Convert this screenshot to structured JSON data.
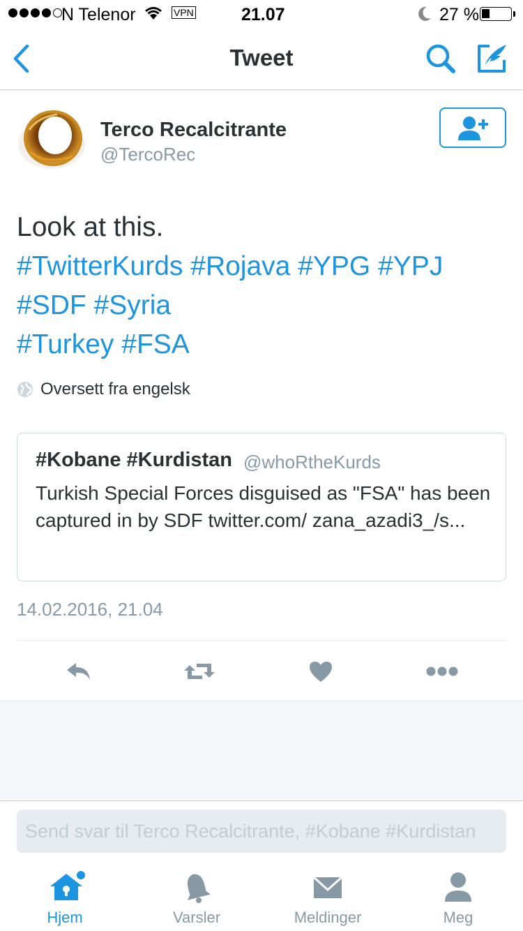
{
  "status_bar": {
    "carrier": "N Telenor",
    "vpn": "VPN",
    "time": "21.07",
    "battery": "27 %",
    "battery_level": 0.27
  },
  "nav": {
    "title": "Tweet"
  },
  "author": {
    "name": "Terco Recalcitrante",
    "handle": "@TercoRec"
  },
  "tweet": {
    "lines": [
      [
        {
          "text": "Look at this.",
          "tag": false
        }
      ],
      [
        {
          "text": "#TwitterKurds",
          "tag": true
        },
        {
          "text": " ",
          "tag": false
        },
        {
          "text": "#Rojava",
          "tag": true
        },
        {
          "text": " ",
          "tag": false
        },
        {
          "text": "#YPG",
          "tag": true
        },
        {
          "text": " ",
          "tag": false
        },
        {
          "text": "#YPJ",
          "tag": true
        }
      ],
      [
        {
          "text": "#SDF",
          "tag": true
        },
        {
          "text": " ",
          "tag": false
        },
        {
          "text": "#Syria",
          "tag": true
        }
      ],
      [
        {
          "text": "#Turkey",
          "tag": true
        },
        {
          "text": " ",
          "tag": false
        },
        {
          "text": "#FSA",
          "tag": true
        }
      ]
    ],
    "translate": "Oversett fra engelsk",
    "timestamp": "14.02.2016, 21.04"
  },
  "quote": {
    "name": "#Kobane #Kurdistan",
    "handle": "@whoRtheKurds",
    "text": "Turkish Special Forces disguised as \"FSA\" has been captured in by SDF twitter.com/ zana_azadi3_/s..."
  },
  "reply": {
    "placeholder": "Send svar til Terco Recalcitrante, #Kobane #Kurdistan"
  },
  "tabs": [
    {
      "label": "Hjem",
      "icon": "home-icon",
      "active": true
    },
    {
      "label": "Varsler",
      "icon": "bell-icon",
      "active": false
    },
    {
      "label": "Meldinger",
      "icon": "envelope-icon",
      "active": false
    },
    {
      "label": "Meg",
      "icon": "person-icon",
      "active": false
    }
  ],
  "colors": {
    "accent": "#1b95e0",
    "text": "#292f33",
    "muted": "#8899a6",
    "action_icon": "#8899a6"
  }
}
